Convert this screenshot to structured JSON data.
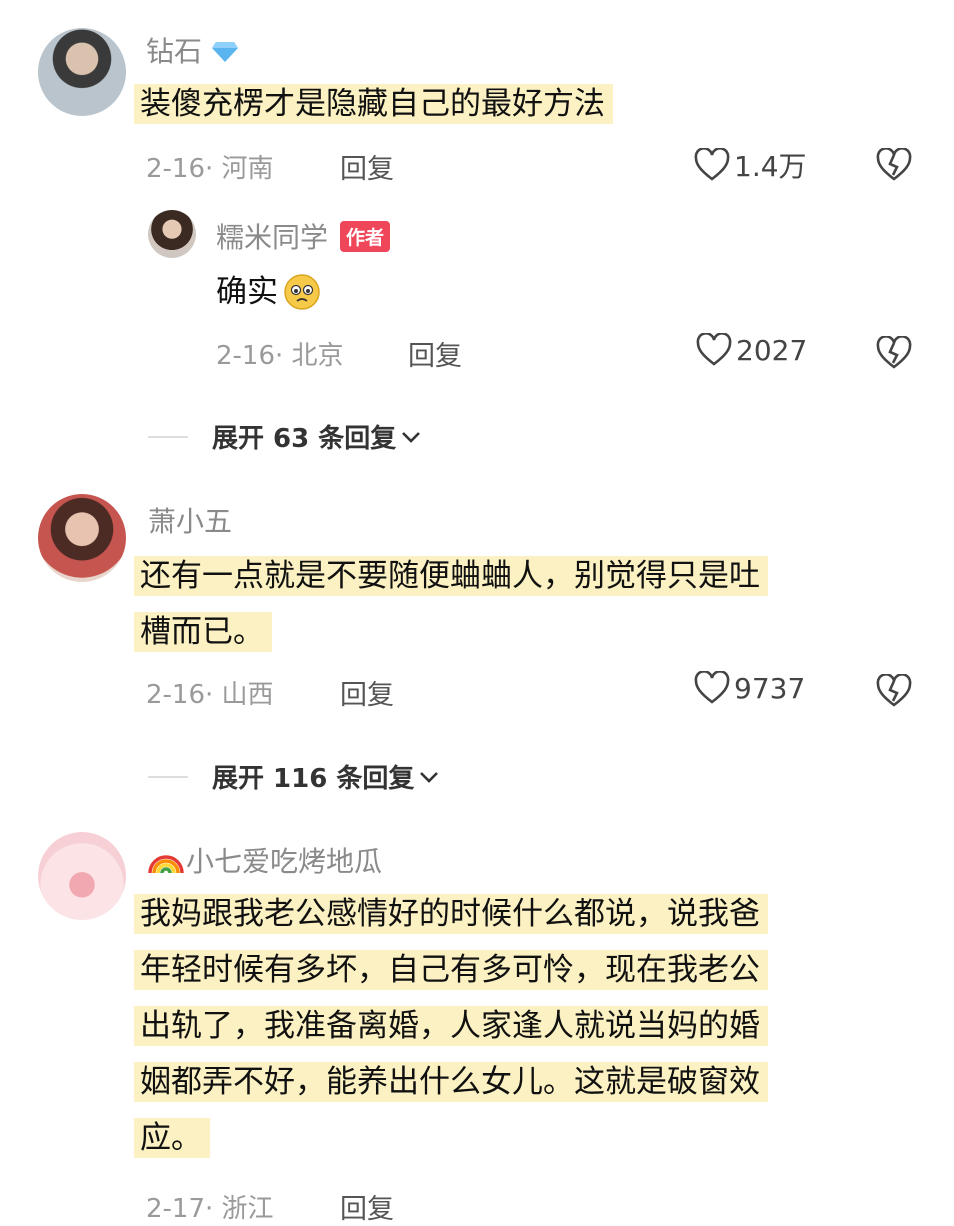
{
  "comments": [
    {
      "username": "钻石",
      "username_icon": "diamond-icon",
      "text_lines": [
        "装傻充楞才是隐藏自己的最好方法"
      ],
      "date_location": "2-16· 河南",
      "reply_label": "回复",
      "likes": "1.4万",
      "replies": [
        {
          "username": "糯米同学",
          "badge": "作者",
          "text": "确实",
          "emoji": "crying-face-icon",
          "date_location": "2-16· 北京",
          "reply_label": "回复",
          "likes": "2027"
        }
      ],
      "expand_label": "展开 63 条回复"
    },
    {
      "username": "萧小五",
      "text_lines": [
        "还有一点就是不要随便蛐蛐人，别觉得只是吐",
        "槽而已。"
      ],
      "date_location": "2-16· 山西",
      "reply_label": "回复",
      "likes": "9737",
      "expand_label": "展开 116 条回复"
    },
    {
      "username": "小七爱吃烤地瓜",
      "username_icon": "rainbow-icon",
      "text_lines": [
        "我妈跟我老公感情好的时候什么都说，说我爸",
        "年轻时候有多坏，自己有多可怜，现在我老公",
        "出轨了，我准备离婚，人家逢人就说当妈的婚",
        "姻都弄不好，能养出什么女儿。这就是破窗效",
        "应。"
      ],
      "date_location": "2-17· 浙江",
      "reply_label": "回复"
    }
  ],
  "colors": {
    "highlight": "#fbf1c2",
    "badge": "#f0465a",
    "meta": "#9a9a9a"
  }
}
